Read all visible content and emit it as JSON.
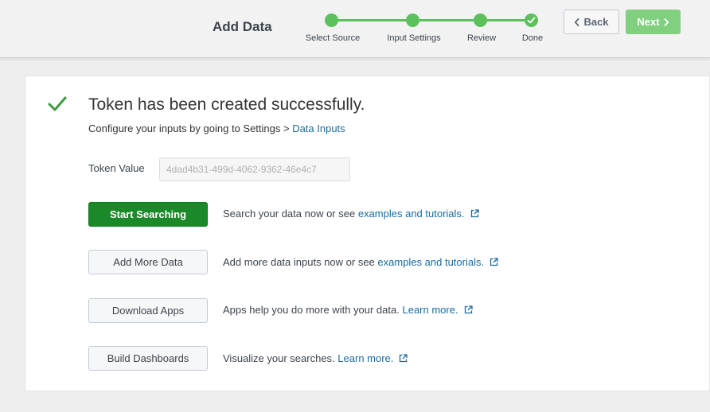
{
  "header": {
    "title": "Add Data",
    "steps": [
      {
        "label": "Select Source",
        "state": "complete"
      },
      {
        "label": "Input Settings",
        "state": "complete"
      },
      {
        "label": "Review",
        "state": "complete"
      },
      {
        "label": "Done",
        "state": "done"
      }
    ],
    "back_label": "Back",
    "next_label": "Next",
    "step_color": "#5cc05c"
  },
  "result": {
    "title": "Token has been created successfully.",
    "subtitle_prefix": "Configure your inputs by going to Settings > ",
    "subtitle_link": "Data Inputs",
    "token_label": "Token Value",
    "token_value": "4dad4b31-499d-4062-9362-46e4c7"
  },
  "actions": [
    {
      "button": "Start Searching",
      "text": "Search your data now or see ",
      "link": "examples and tutorials.",
      "primary": true
    },
    {
      "button": "Add More Data",
      "text": "Add more data inputs now or see ",
      "link": "examples and tutorials.",
      "primary": false
    },
    {
      "button": "Download Apps",
      "text": "Apps help you do more with your data. ",
      "link": "Learn more.",
      "primary": false
    },
    {
      "button": "Build Dashboards",
      "text": "Visualize your searches. ",
      "link": "Learn more.",
      "primary": false
    }
  ],
  "colors": {
    "primary_green": "#1a8929",
    "link_blue": "#1a6ba0",
    "check_green": "#3c9a3c"
  }
}
